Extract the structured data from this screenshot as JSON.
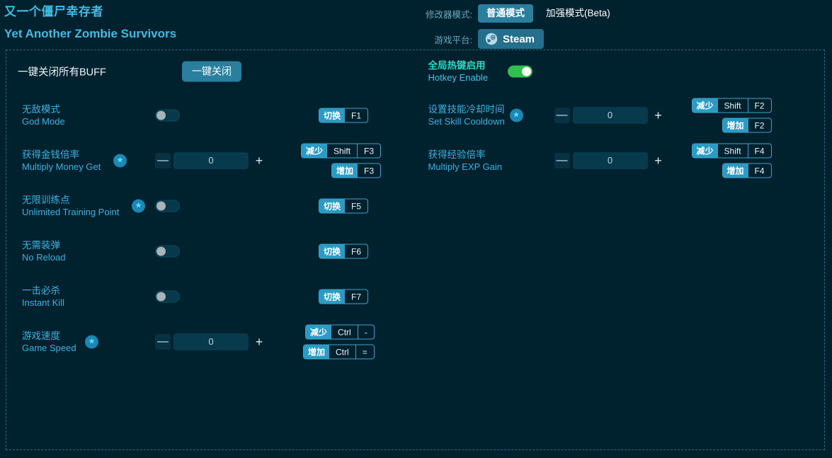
{
  "header": {
    "title_cn": "又一个僵尸幸存者",
    "title_en": "Yet Another Zombie Survivors",
    "mode_label": "修改器模式:",
    "mode_normal": "普通模式",
    "mode_enhanced": "加强模式(Beta)",
    "platform_label": "游戏平台:",
    "platform_value": "Steam",
    "platform_icon": "steam-icon"
  },
  "colors": {
    "background": "#00212e",
    "accent": "#2a9bc4",
    "button": "#2a7f9e",
    "label": "#3fb2e0",
    "title": "#3fbde4",
    "toggle_on": "#2ec04b",
    "star_badge": "#1a87b5",
    "panel_border": "#2e6d84"
  },
  "left_column": {
    "buff_row": {
      "label": "一键关闭所有BUFF",
      "button": "一键关闭"
    },
    "rows": [
      {
        "cn": "无敌模式",
        "en": "God Mode",
        "star": false,
        "control": "toggle",
        "toggle_on": false,
        "hotkeys": [
          {
            "action": "切换",
            "keys": [
              "F1"
            ]
          }
        ]
      },
      {
        "cn": "获得金钱倍率",
        "en": "Multiply Money Get",
        "star": true,
        "control": "stepper",
        "value": "0",
        "hotkeys": [
          {
            "action": "减少",
            "keys": [
              "Shift",
              "F3"
            ]
          },
          {
            "action": "增加",
            "keys": [
              "F3"
            ]
          }
        ]
      },
      {
        "cn": "无限训练点",
        "en": "Unlimited Training Point",
        "star": true,
        "control": "toggle",
        "toggle_on": false,
        "hotkeys": [
          {
            "action": "切换",
            "keys": [
              "F5"
            ]
          }
        ]
      },
      {
        "cn": "无需装弹",
        "en": "No Reload",
        "star": false,
        "control": "toggle",
        "toggle_on": false,
        "hotkeys": [
          {
            "action": "切换",
            "keys": [
              "F6"
            ]
          }
        ]
      },
      {
        "cn": "一击必杀",
        "en": "Instant Kill",
        "star": false,
        "control": "toggle",
        "toggle_on": false,
        "hotkeys": [
          {
            "action": "切换",
            "keys": [
              "F7"
            ]
          }
        ]
      },
      {
        "cn": "游戏速度",
        "en": "Game Speed",
        "star": true,
        "control": "stepper",
        "value": "0",
        "hotkeys": [
          {
            "action": "减少",
            "keys": [
              "Ctrl",
              "-"
            ]
          },
          {
            "action": "增加",
            "keys": [
              "Ctrl",
              "="
            ]
          }
        ]
      }
    ]
  },
  "right_column": {
    "hotkey_enable": {
      "cn": "全局热键启用",
      "en": "Hotkey Enable",
      "toggle_on": true
    },
    "rows": [
      {
        "cn": "设置技能冷却时间",
        "en": "Set Skill Cooldown",
        "star": true,
        "control": "stepper",
        "value": "0",
        "hotkeys": [
          {
            "action": "减少",
            "keys": [
              "Shift",
              "F2"
            ]
          },
          {
            "action": "增加",
            "keys": [
              "F2"
            ]
          }
        ]
      },
      {
        "cn": "获得经验倍率",
        "en": "Multiply EXP Gain",
        "star": false,
        "control": "stepper",
        "value": "0",
        "hotkeys": [
          {
            "action": "减少",
            "keys": [
              "Shift",
              "F4"
            ]
          },
          {
            "action": "增加",
            "keys": [
              "F4"
            ]
          }
        ]
      }
    ]
  }
}
